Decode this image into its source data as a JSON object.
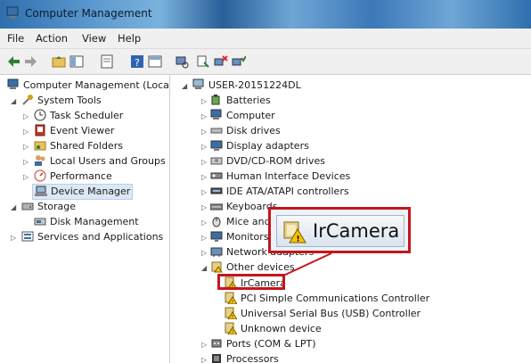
{
  "window": {
    "title": "Computer Management"
  },
  "menu": [
    "File",
    "Action",
    "View",
    "Help"
  ],
  "left_tree": {
    "root": "Computer Management (Local",
    "items": [
      {
        "label": "System Tools",
        "level": 1
      },
      {
        "label": "Task Scheduler",
        "level": 2
      },
      {
        "label": "Event Viewer",
        "level": 2
      },
      {
        "label": "Shared Folders",
        "level": 2
      },
      {
        "label": "Local Users and Groups",
        "level": 2
      },
      {
        "label": "Performance",
        "level": 2
      },
      {
        "label": "Device Manager",
        "level": 2
      },
      {
        "label": "Storage",
        "level": 1
      },
      {
        "label": "Disk Management",
        "level": 2
      },
      {
        "label": "Services and Applications",
        "level": 1
      }
    ]
  },
  "device_tree": {
    "root": "USER-20151224DL",
    "items": [
      "Batteries",
      "Computer",
      "Disk drives",
      "Display adapters",
      "DVD/CD-ROM drives",
      "Human Interface Devices",
      "IDE ATA/ATAPI controllers",
      "Keyboards",
      "Mice and",
      "Monitors",
      "Network adapters",
      "Other devices"
    ],
    "other_devices": [
      "IrCamera",
      "PCI Simple Communications Controller",
      "Universal Serial Bus (USB) Controller",
      "Unknown device"
    ],
    "after": [
      "Ports (COM & LPT)",
      "Processors"
    ]
  },
  "callout": {
    "label": "IrCamera"
  },
  "colors": {
    "highlight": "#c4161c",
    "selection": "#dde8f5"
  }
}
